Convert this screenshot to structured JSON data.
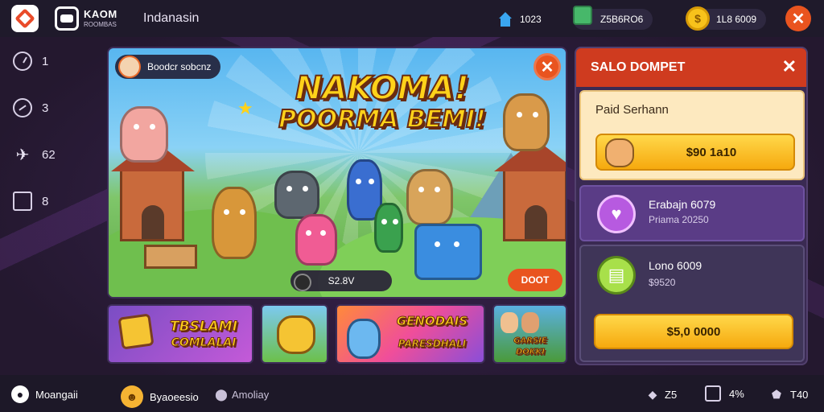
{
  "header": {
    "brand_title": "KAOM",
    "brand_subtitle": "ROOMBAS",
    "region": "Indanasin",
    "stat_home": "1023",
    "stat_gifts": "Z5B6RO6",
    "stat_coins": "1L8 6009"
  },
  "sidebar": {
    "items": [
      {
        "value": "1",
        "icon": "clock-icon"
      },
      {
        "value": "3",
        "icon": "dashboard-icon"
      },
      {
        "value": "62",
        "icon": "plane-icon"
      },
      {
        "value": "8",
        "icon": "box-icon"
      }
    ]
  },
  "banner": {
    "player_tag": "Boodcr sobcnz",
    "headline_line1": "NAKOMA!",
    "headline_line2": "POORMA BEMI!",
    "price": "S2.8V",
    "cta": "DOOT"
  },
  "thumbnails": [
    {
      "title_line1": "TBSLAMI",
      "title_line2": "COMLALAI"
    },
    {
      "title_line1": "",
      "title_line2": ""
    },
    {
      "title_line1": "GENODAIS",
      "title_line2": "PARESDHALI"
    },
    {
      "title_line1": "GARSIE",
      "title_line2": "DOKKI"
    }
  ],
  "panel": {
    "title": "SALO DOMPET",
    "card1": {
      "title": "Paid Serhann",
      "button": "$90 1a10"
    },
    "card2": {
      "title": "Erabajn 6079",
      "subtitle": "Priama 20250"
    },
    "card3": {
      "title": "Lono 6009",
      "subtitle": "$9520",
      "button": "$5,0 0000"
    }
  },
  "bottom": {
    "left_label": "Moangaii",
    "mid_label": "Byaoeesio",
    "mid2_label": "Amoliay",
    "stat1": "Z5",
    "stat2": "4%",
    "stat3": "T40"
  },
  "colors": {
    "accent_orange": "#e9541f",
    "panel_red": "#cf3b1f",
    "gold": "#ffd21a"
  }
}
